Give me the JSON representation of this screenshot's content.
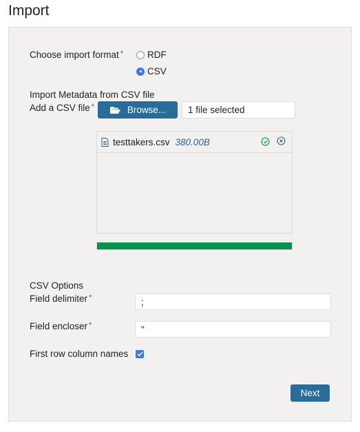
{
  "page": {
    "title": "Import"
  },
  "format": {
    "label": "Choose import format",
    "required_mark": "*",
    "options": [
      {
        "label": "RDF",
        "checked": false
      },
      {
        "label": "CSV",
        "checked": true
      }
    ]
  },
  "metadata": {
    "section_label": "Import Metadata from CSV file",
    "add_label": "Add a CSV file",
    "required_mark": "*",
    "browse_label": "Browse...",
    "browse_icon": "folder-open-icon",
    "selection_status": "1 file selected"
  },
  "files": [
    {
      "icon": "file-text-icon",
      "name": "testtakers.csv",
      "size": "380.00B",
      "status_icon": "check-circle-icon",
      "remove_icon": "remove-circle-icon"
    }
  ],
  "upload": {
    "progress_percent": 100
  },
  "csv_options": {
    "section_label": "CSV Options",
    "delimiter_label": "Field delimiter",
    "delimiter_value": ";",
    "encloser_label": "Field encloser",
    "encloser_value": "\"",
    "required_mark": "*",
    "first_row_label": "First row column names",
    "first_row_checked": true
  },
  "actions": {
    "next_label": "Next"
  },
  "colors": {
    "accent": "#266d9c",
    "radio_checked": "#3c78e8",
    "progress": "#00944a",
    "success": "#27a35a",
    "link": "#2a6496"
  }
}
